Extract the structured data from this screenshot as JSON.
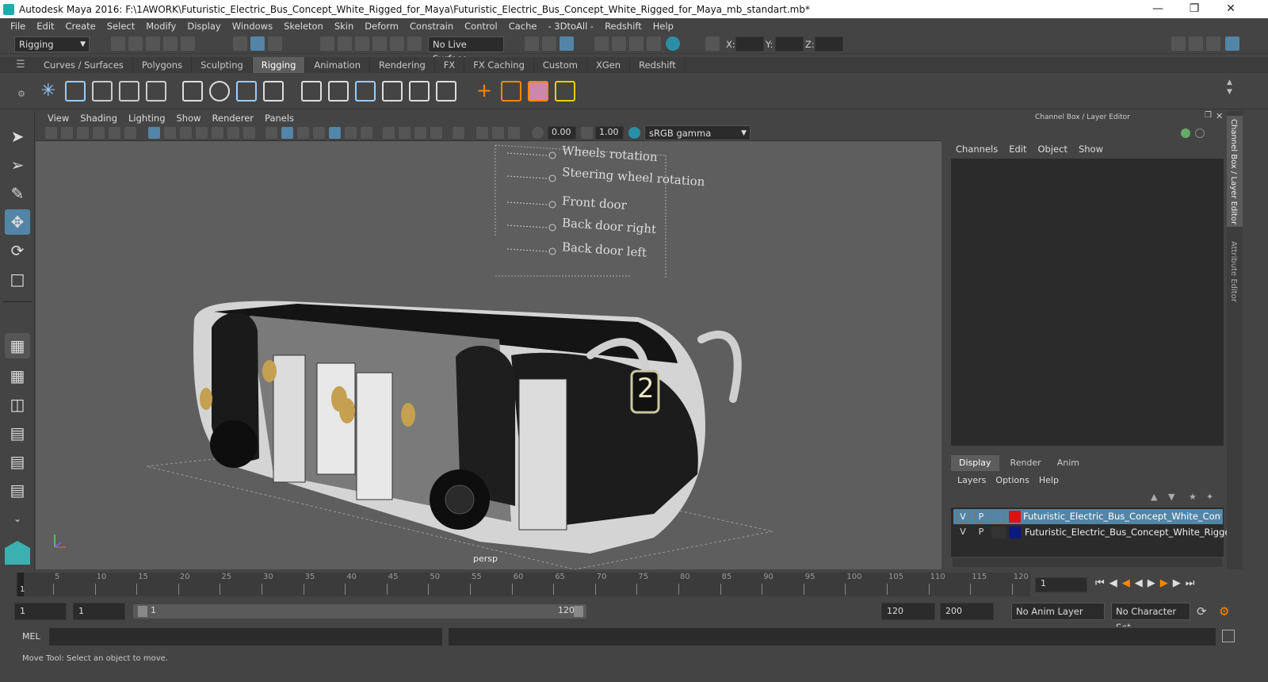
{
  "window": {
    "title": "Autodesk Maya 2016: F:\\1AWORK\\Futuristic_Electric_Bus_Concept_White_Rigged_for_Maya\\Futuristic_Electric_Bus_Concept_White_Rigged_for_Maya_mb_standart.mb*"
  },
  "menus": [
    "File",
    "Edit",
    "Create",
    "Select",
    "Modify",
    "Display",
    "Windows",
    "Skeleton",
    "Skin",
    "Deform",
    "Constrain",
    "Control",
    "Cache",
    "- 3DtoAll -",
    "Redshift",
    "Help"
  ],
  "status": {
    "menu_set": "Rigging",
    "live_surface": "No Live Surface",
    "x_label": "X:",
    "y_label": "Y:",
    "z_label": "Z:"
  },
  "shelf_tabs": [
    "Curves / Surfaces",
    "Polygons",
    "Sculpting",
    "Rigging",
    "Animation",
    "Rendering",
    "FX",
    "FX Caching",
    "Custom",
    "XGen",
    "Redshift"
  ],
  "viewport": {
    "menus": [
      "View",
      "Shading",
      "Lighting",
      "Show",
      "Renderer",
      "Panels"
    ],
    "exposure": "0.00",
    "gamma": "1.00",
    "color_space": "sRGB gamma",
    "camera_label": "persp",
    "controllers": [
      "Wheels rotation",
      "Steering wheel rotation",
      "Front door",
      "Back door right",
      "Back door left"
    ],
    "bus_number": "2"
  },
  "channel_box": {
    "title": "Channel Box / Layer Editor",
    "menus": [
      "Channels",
      "Edit",
      "Object",
      "Show"
    ],
    "tabs": [
      "Display",
      "Render",
      "Anim"
    ],
    "layer_menus": [
      "Layers",
      "Options",
      "Help"
    ],
    "layers": [
      {
        "v": "V",
        "p": "P",
        "color": "#e01010",
        "name": "Futuristic_Electric_Bus_Concept_White_Controllers"
      },
      {
        "v": "V",
        "p": "P",
        "color": "#0b1a80",
        "name": "Futuristic_Electric_Bus_Concept_White_Rigged"
      }
    ]
  },
  "side_tabs": [
    "Channel Box / Layer Editor",
    "Attribute Editor"
  ],
  "timeline": {
    "ticks": [
      "5",
      "10",
      "15",
      "20",
      "25",
      "30",
      "35",
      "40",
      "45",
      "50",
      "55",
      "60",
      "65",
      "70",
      "75",
      "80",
      "85",
      "90",
      "95",
      "100",
      "105",
      "110",
      "115",
      "120"
    ],
    "start_marker": "1",
    "current_frame": "1"
  },
  "range": {
    "start": "1",
    "playback_start": "1",
    "slider_start": "1",
    "slider_end": "120",
    "playback_end": "120",
    "end": "200",
    "anim_layer": "No Anim Layer",
    "char_set": "No Character Set"
  },
  "command": {
    "label": "MEL"
  },
  "help": {
    "text": "Move Tool: Select an object to move."
  }
}
